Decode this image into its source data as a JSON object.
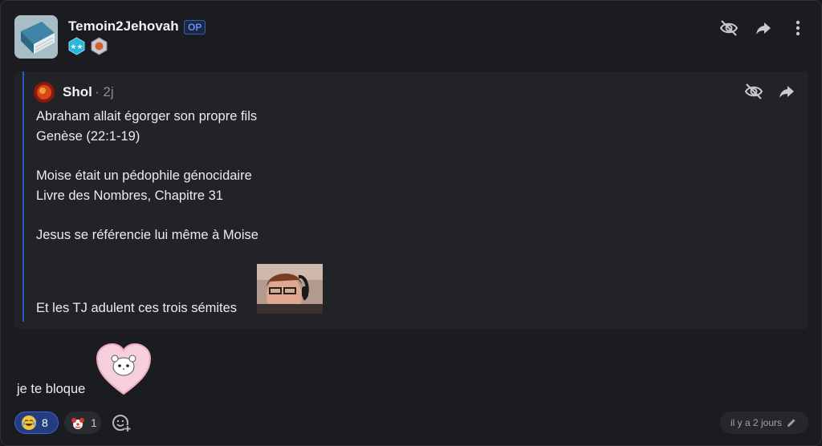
{
  "post": {
    "author": "Temoin2Jehovah",
    "op_badge": "OP",
    "icons": [
      "hide-icon",
      "share-icon",
      "more-options-icon"
    ],
    "quote": {
      "author": "Shol",
      "time": "· 2j",
      "lines": [
        "Abraham allait égorger son propre fils",
        "Genèse (22:1-19)",
        "Moise était un pédophile génocidaire",
        "Livre des Nombres, Chapitre 31",
        "Jesus se référencie lui même à Moise",
        "Et les TJ adulent ces trois sémites"
      ]
    },
    "text": "je te bloque",
    "reactions": [
      {
        "emoji": "crying-laugh-emoji",
        "count": "8",
        "selected": true
      },
      {
        "emoji": "clown-emoji",
        "count": "1",
        "selected": false
      }
    ],
    "timestamp": "il y a 2 jours",
    "colors": {
      "accent": "#3a63d6",
      "quote_bar": "#2f55c8",
      "background": "#1b1c20"
    }
  }
}
